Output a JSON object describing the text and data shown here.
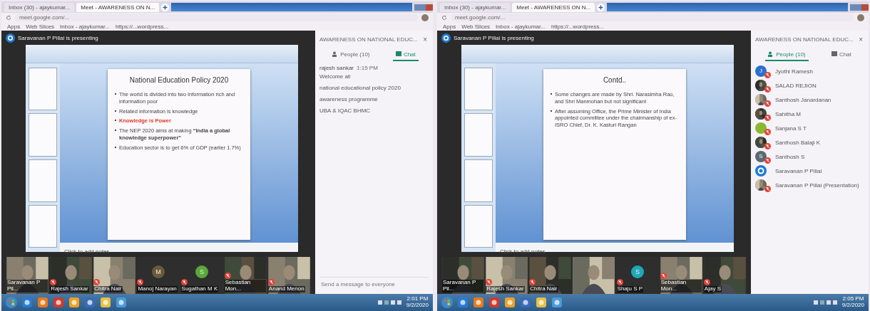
{
  "screens": [
    {
      "browser": {
        "tabs": [
          {
            "label": "Inbox (30) - ajaykumar...",
            "selected": false
          },
          {
            "label": "Meet - AWARENESS ON N...",
            "selected": true
          }
        ],
        "url": "meet.google.com/...",
        "bookmarks": [
          "Apps",
          "Web Slices",
          "Inbox - ajaykumar...",
          "https://...wordpress..."
        ]
      },
      "banner": "Saravanan P Pillai is presenting",
      "slide": {
        "title": "National Education Policy 2020",
        "bullets": [
          {
            "text": "The world is divided into two information rich and information poor",
            "emphasis": false
          },
          {
            "text": "Related information is knowledge",
            "emphasis": false
          },
          {
            "text": "Knowledge is Power",
            "emphasis": true
          },
          {
            "text": "The NEP 2020 aims at making **“India a global knowledge superpower”**",
            "emphasis": false
          },
          {
            "text": "Education sector is to get 6% of GDP (earlier 1.7%)",
            "emphasis": false
          }
        ]
      },
      "notes": "Click to add notes",
      "tiles": [
        {
          "name": "Saravanan P Pil...",
          "kind": "video",
          "muted": false
        },
        {
          "name": "Rajesh Sankar",
          "kind": "video",
          "muted": true
        },
        {
          "name": "Chitra Nair",
          "kind": "video",
          "muted": true
        },
        {
          "name": "Manoj Narayan",
          "kind": "avatar",
          "initial": "M",
          "color": "#6b5a3a",
          "muted": true
        },
        {
          "name": "Sugathan M K",
          "kind": "avatar",
          "initial": "S",
          "color": "#5aa83a",
          "muted": true
        },
        {
          "name": "Sebastian Mon...",
          "kind": "video",
          "muted": true
        },
        {
          "name": "Anand Menon",
          "kind": "video",
          "muted": true
        }
      ],
      "side_panel": {
        "title": "AWARENESS ON NATIONAL EDUC...",
        "close": "×",
        "kind": "chat",
        "tabs": [
          {
            "label": "People (10)",
            "selected": false
          },
          {
            "label": "Chat",
            "selected": true
          }
        ],
        "messages": [
          {
            "sender": "rajesh sankar",
            "time": "1:15 PM",
            "lines": [
              "Welcome all",
              "national educational policy 2020",
              "awareness programme",
              "UBA & IQAC BHMC"
            ]
          }
        ],
        "placeholder": "Send a message to everyone"
      },
      "taskbar": {
        "time": "2:01 PM",
        "date": "9/2/2020"
      }
    },
    {
      "browser": {
        "tabs": [
          {
            "label": "Inbox (30) - ajaykumar...",
            "selected": false
          },
          {
            "label": "Meet - AWARENESS ON N...",
            "selected": true
          }
        ],
        "url": "meet.google.com/...",
        "bookmarks": [
          "Apps",
          "Web Slices",
          "Inbox - ajaykumar...",
          "https://...wordpress..."
        ]
      },
      "banner": "Saravanan P Pillai is presenting",
      "slide": {
        "title": "Contd..",
        "bullets": [
          {
            "text": "Some changes are made by Shri. Narasimha Rao, and Shri Manmohan but not significant",
            "emphasis": false
          },
          {
            "text": "After assuming Office, the Prime Minister of India appointed committee under the chairmanship of ex-ISRO Chief, Dr. K. Kasturi Rangan",
            "emphasis": false
          }
        ]
      },
      "notes": "Click to add notes",
      "tiles": [
        {
          "name": "Saravanan P Pil...",
          "kind": "video",
          "muted": false
        },
        {
          "name": "Rajesh Sankar",
          "kind": "video",
          "muted": true
        },
        {
          "name": "Chitra Nair",
          "kind": "video",
          "muted": true
        },
        {
          "kind": "video",
          "muted": false
        },
        {
          "name": "Shaju S P",
          "kind": "avatar",
          "initial": "S",
          "color": "#20a8b8",
          "muted": true
        },
        {
          "name": "Sebastian Mon...",
          "kind": "video",
          "muted": true
        },
        {
          "name": "Ajay S",
          "kind": "video",
          "muted": true
        }
      ],
      "side_panel": {
        "title": "AWARENESS ON NATIONAL EDUC...",
        "close": "×",
        "kind": "people",
        "tabs": [
          {
            "label": "People (10)",
            "selected": true
          },
          {
            "label": "Chat",
            "selected": false
          }
        ],
        "people": [
          {
            "name": "Jyothi Ramesh",
            "kind": "avatar",
            "initial": "J",
            "color": "#2a6fd0",
            "muted": true
          },
          {
            "name": "SALAD REJION",
            "muted": true
          },
          {
            "name": "Santhosh Janardanan",
            "muted": true
          },
          {
            "name": "Sahitha M",
            "muted": true
          },
          {
            "name": "Sanjana S T",
            "kind": "avatar",
            "color": "#8ab830",
            "muted": true
          },
          {
            "name": "Santhosh Balaji K",
            "muted": true
          },
          {
            "name": "Santhosh S",
            "kind": "avatar",
            "initial": "S",
            "color": "#5a6a70",
            "muted": true
          },
          {
            "name": "Saravanan P Pillai",
            "kind": "logo",
            "muted": false
          },
          {
            "name": "Saravanan P Pillai (Presentation)",
            "muted": true
          }
        ]
      },
      "taskbar": {
        "time": "2:05 PM",
        "date": "9/2/2020"
      }
    }
  ]
}
